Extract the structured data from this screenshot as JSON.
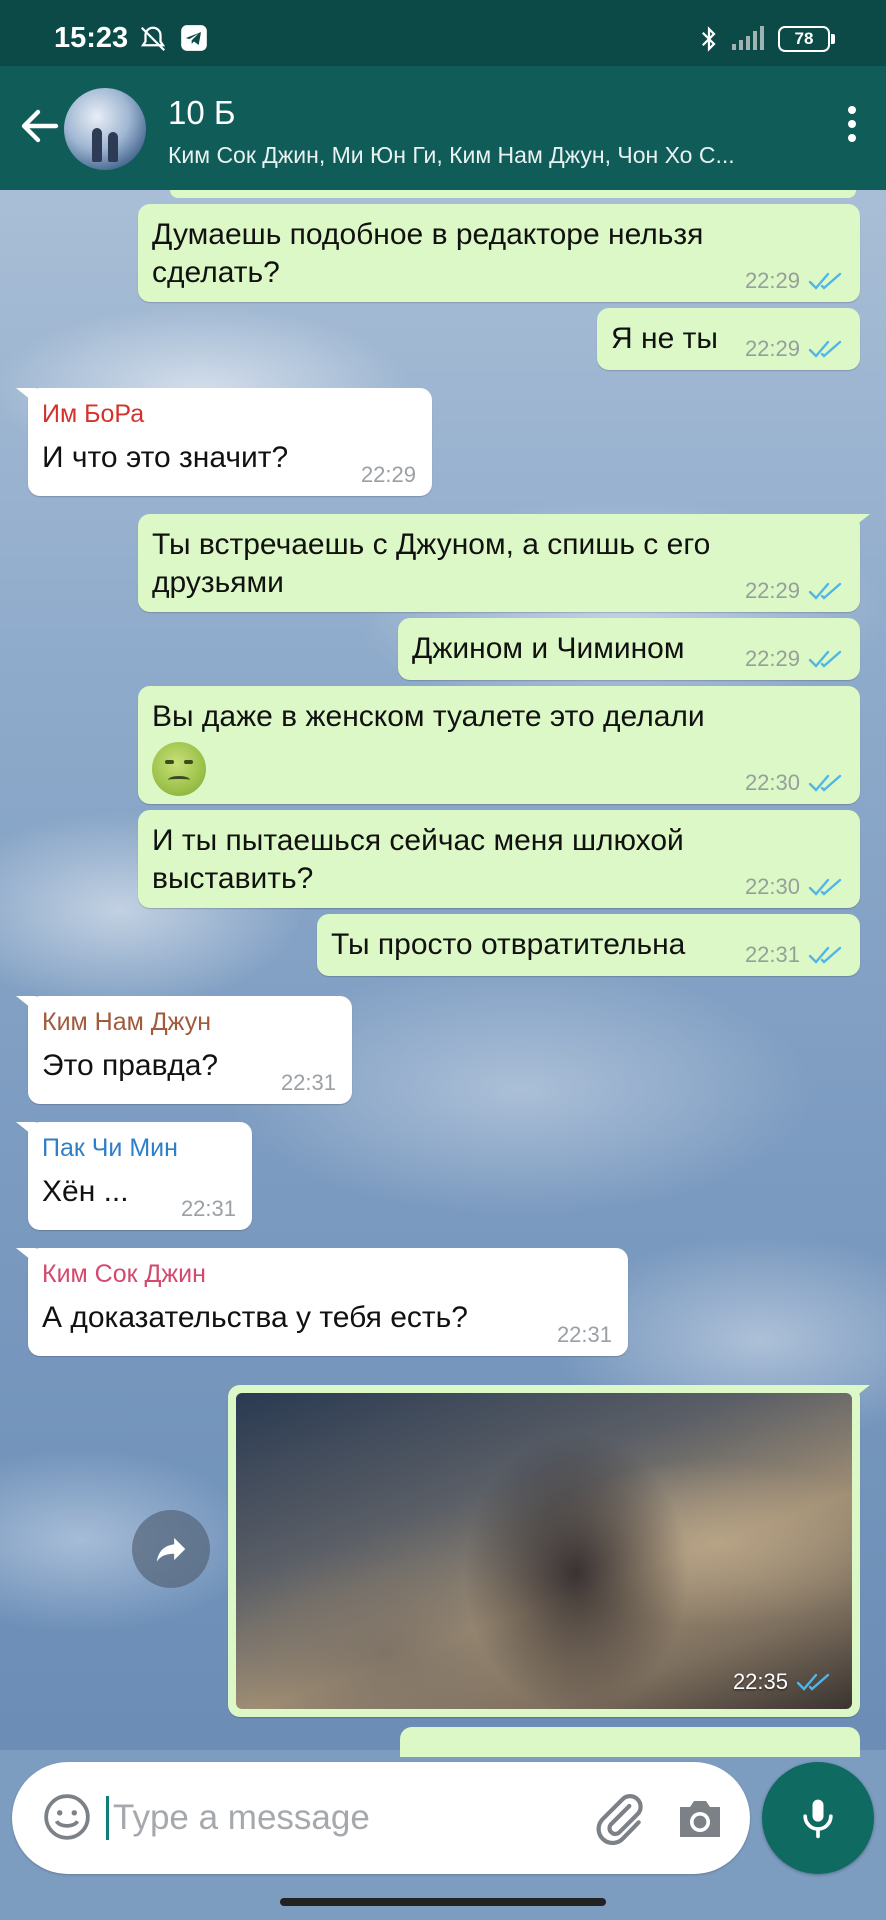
{
  "status_bar": {
    "time": "15:23",
    "battery": "78",
    "icons": [
      "mute-bell-icon",
      "telegram-icon",
      "bluetooth-icon",
      "signal-icon",
      "battery-icon"
    ]
  },
  "header": {
    "title": "10 Б",
    "subtitle": "Ким Сок Джин, Ми Юн Ги, Ким Нам Джун, Чон Хо С..."
  },
  "messages": [
    {
      "dir": "out",
      "text": "Думаешь подобное в редакторе нельзя сделать?",
      "time": "22:29",
      "read": true
    },
    {
      "dir": "out",
      "text": "Я не ты",
      "time": "22:29",
      "read": true
    },
    {
      "dir": "in",
      "sender": "Им БоРа",
      "sender_color": "#d4322c",
      "text": "И что это значит?",
      "time": "22:29"
    },
    {
      "dir": "out",
      "text": "Ты встречаешь с Джуном, а спишь с его друзьями",
      "time": "22:29",
      "read": true
    },
    {
      "dir": "out",
      "text": "Джином и Чимином",
      "time": "22:29",
      "read": true
    },
    {
      "dir": "out",
      "text": "Вы даже в женском туалете это делали",
      "emoji": "nauseated-face",
      "time": "22:30",
      "read": true
    },
    {
      "dir": "out",
      "text": "И ты пытаешься сейчас меня шлюхой выставить?",
      "time": "22:30",
      "read": true
    },
    {
      "dir": "out",
      "text": "Ты просто отвратительна",
      "time": "22:31",
      "read": true
    },
    {
      "dir": "in",
      "sender": "Ким Нам Джун",
      "sender_color": "#a15a3c",
      "text": "Это правда?",
      "time": "22:31"
    },
    {
      "dir": "in",
      "sender": "Пак Чи Мин",
      "sender_color": "#2f7fc8",
      "text": "Хён ...",
      "time": "22:31"
    },
    {
      "dir": "in",
      "sender": "Ким Сок Джин",
      "sender_color": "#d4496e",
      "text": "А доказательства у тебя есть?",
      "time": "22:31"
    },
    {
      "dir": "out",
      "type": "photo",
      "time": "22:35",
      "read": true
    }
  ],
  "composer": {
    "placeholder": "Type a message"
  },
  "colors": {
    "header": "#0f5c58",
    "status_bar": "#0c4a48",
    "outgoing_bubble": "#dcf8c6",
    "incoming_bubble": "#ffffff",
    "read_ticks": "#4fb6ec",
    "mic_button": "#0f6b62"
  }
}
